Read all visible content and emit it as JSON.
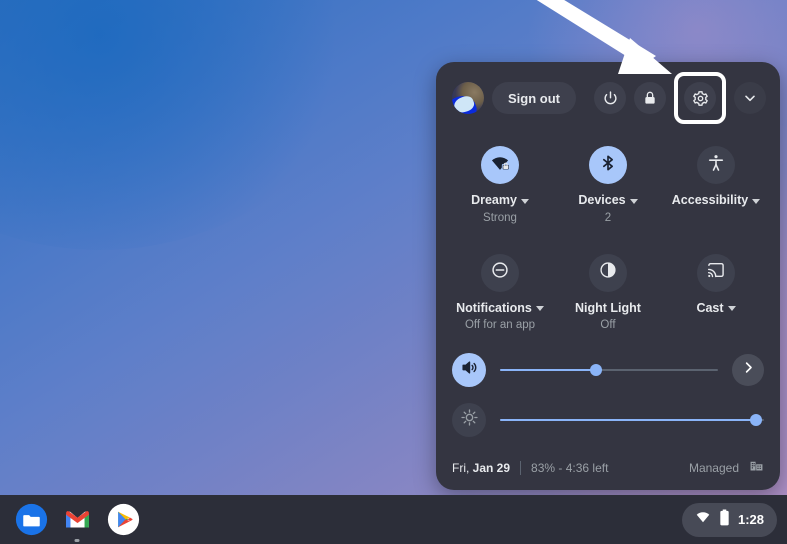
{
  "wallpaper": {
    "gradient_from": "#2f6fbf",
    "gradient_to": "#bb95ca"
  },
  "annotation": {
    "type": "arrow",
    "color": "#ffffff",
    "points_to": "settings-button"
  },
  "quick_settings": {
    "header": {
      "avatar_name": "user-avatar",
      "sign_out_label": "Sign out",
      "power_label": "power-icon",
      "lock_label": "lock-icon",
      "settings_label": "gear-icon",
      "collapse_label": "chevron-down-icon",
      "settings_highlighted": true,
      "highlight_color": "#ffffff"
    },
    "tiles": [
      {
        "id": "network",
        "icon": "wifi-locked-icon",
        "label": "Dreamy",
        "sublabel": "Strong",
        "has_caret": true,
        "active": true
      },
      {
        "id": "bluetooth",
        "icon": "bluetooth-icon",
        "label": "Devices",
        "sublabel": "2",
        "has_caret": true,
        "active": true
      },
      {
        "id": "accessibility",
        "icon": "accessibility-icon",
        "label": "Accessibility",
        "sublabel": "",
        "has_caret": true,
        "active": false
      },
      {
        "id": "notifications",
        "icon": "do-not-disturb-icon",
        "label": "Notifications",
        "sublabel": "Off for an app",
        "has_caret": true,
        "active": false
      },
      {
        "id": "night-light",
        "icon": "moon-icon",
        "label": "Night Light",
        "sublabel": "Off",
        "has_caret": false,
        "active": false
      },
      {
        "id": "cast",
        "icon": "cast-icon",
        "label": "Cast",
        "sublabel": "",
        "has_caret": true,
        "active": false
      }
    ],
    "sliders": [
      {
        "id": "volume",
        "icon": "volume-up-icon",
        "value": 44,
        "active": true,
        "has_next_button": true,
        "next_icon": "chevron-right-icon"
      },
      {
        "id": "brightness",
        "icon": "brightness-icon",
        "value": 97,
        "active": false,
        "has_next_button": false,
        "next_icon": ""
      }
    ],
    "footer": {
      "date_prefix": "Fri, ",
      "date_value": "Jan 29",
      "battery_text": "83% - 4:36 left",
      "managed_label": "Managed",
      "managed_icon": "enterprise-building-icon"
    },
    "colors": {
      "panel_bg": "#343541",
      "tile_active": "#a8c7fa",
      "tile_inactive": "#3e414e",
      "slider_fill": "#8ab4f8",
      "text_primary": "#e8eaed",
      "text_secondary": "#9aa0a6"
    }
  },
  "shelf": {
    "apps": [
      {
        "id": "files",
        "name": "files-app-icon",
        "running": false
      },
      {
        "id": "gmail",
        "name": "gmail-app-icon",
        "running": true
      },
      {
        "id": "play-store",
        "name": "play-store-app-icon",
        "running": false
      }
    ],
    "status_tray": {
      "wifi_icon": "wifi-icon",
      "battery_icon": "battery-icon",
      "time": "1:28"
    }
  }
}
